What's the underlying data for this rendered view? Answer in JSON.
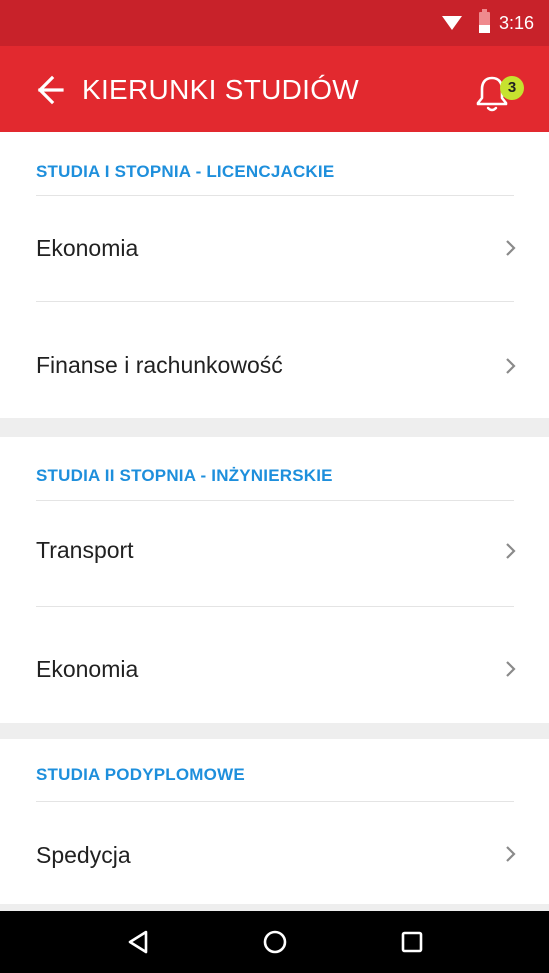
{
  "status_bar": {
    "time": "3:16",
    "icons": [
      "wifi-icon",
      "battery-icon"
    ]
  },
  "app_bar": {
    "title": "KIERUNKI STUDIÓW",
    "back_icon": "arrow-left-icon",
    "bell_icon": "bell-icon",
    "notification_count": "3",
    "background_color": "#e2292f",
    "badge_color": "#c6e22f"
  },
  "sections": [
    {
      "header": "STUDIA I STOPNIA - LICENCJACKIE",
      "items": [
        {
          "label": "Ekonomia"
        },
        {
          "label": "Finanse i rachunkowość"
        }
      ]
    },
    {
      "header": "STUDIA II STOPNIA - INŻYNIERSKIE",
      "items": [
        {
          "label": "Transport"
        },
        {
          "label": "Ekonomia"
        }
      ]
    },
    {
      "header": "STUDIA PODYPLOMOWE",
      "items": [
        {
          "label": "Spedycja"
        }
      ]
    }
  ],
  "nav_bar": {
    "icons": [
      "back-triangle-icon",
      "home-circle-icon",
      "recents-square-icon"
    ]
  },
  "colors": {
    "section_header": "#1e8fdc",
    "status_bar": "#c8222a"
  }
}
